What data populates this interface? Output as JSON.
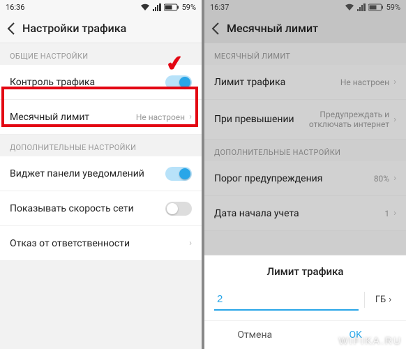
{
  "left": {
    "status": {
      "time": "16:36",
      "battery": "59%"
    },
    "title": "Настройки трафика",
    "sections": {
      "general_label": "ОБЩИЕ НАСТРОЙКИ",
      "additional_label": "ДОПОЛНИТЕЛЬНЫЕ НАСТРОЙКИ"
    },
    "rows": {
      "traffic_control": "Контроль трафика",
      "monthly_limit": {
        "label": "Месячный лимит",
        "value": "Не настроен"
      },
      "widget": "Виджет панели уведомлений",
      "net_speed": "Показывать скорость сети",
      "disclaimer": "Отказ от ответственности"
    }
  },
  "right": {
    "status": {
      "time": "16:37",
      "battery": "59%"
    },
    "title": "Месячный лимит",
    "sections": {
      "limit_label": "МЕСЯЧНЫЙ ЛИМИТ",
      "additional_label": "ДОПОЛНИТЕЛЬНЫЕ НАСТРОЙКИ"
    },
    "rows": {
      "traffic_limit": {
        "label": "Лимит трафика",
        "value": "Не настроен"
      },
      "on_exceed": {
        "label": "При превышении",
        "value": "Предупреждать и отключать интернет"
      },
      "warn_threshold": {
        "label": "Порог предупреждения",
        "value": "80%"
      },
      "start_date": {
        "label": "Дата начала учета",
        "value": "1"
      }
    },
    "modal": {
      "title": "Лимит трафика",
      "value": "2",
      "unit": "ГБ",
      "cancel": "Отмена",
      "ok": "OK"
    }
  },
  "watermark": "WIFIKA.RU"
}
